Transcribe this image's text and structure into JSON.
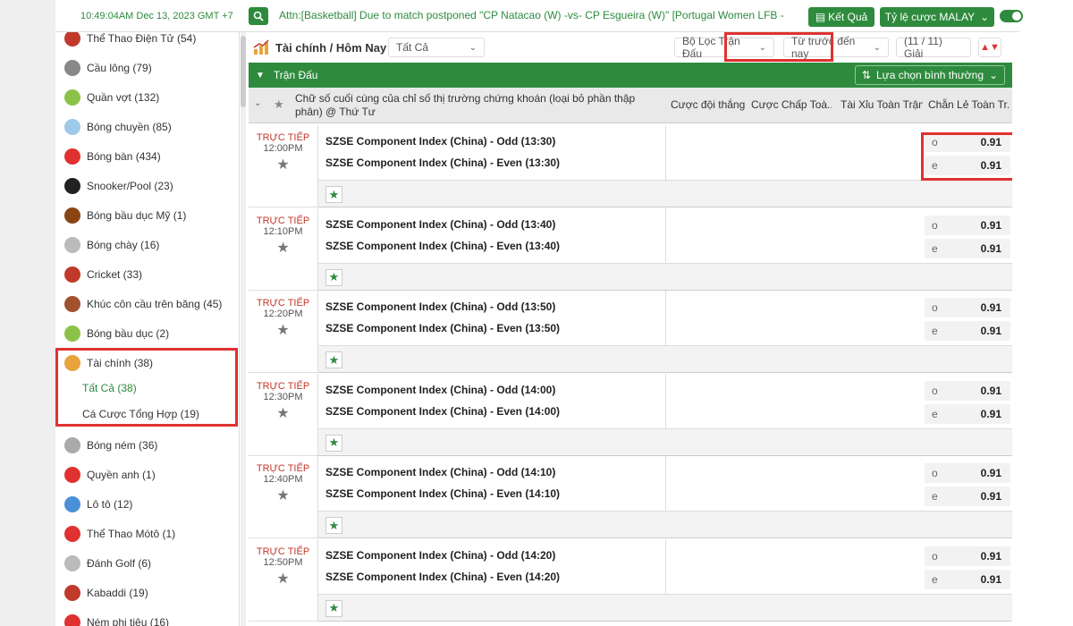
{
  "topbar": {
    "clock": "10:49:04AM Dec 13, 2023 GMT +7",
    "marquee": "Attn:[Basketball] Due to match postponed \"CP Natacao (W) -vs- CP Esgueira (W)\" [Portugal Women LFB -",
    "result_label": "Kết Quả",
    "odds_label": "Tỷ lệ cược MALAY"
  },
  "sidebar": {
    "items": [
      {
        "label": "Thể Thao Điện Tử (54)",
        "icon": "esports-icon",
        "color": "#c0392b"
      },
      {
        "label": "Cầu lông (79)",
        "icon": "badminton-icon",
        "color": "#888888"
      },
      {
        "label": "Quần vợt (132)",
        "icon": "tennis-icon",
        "color": "#8bc34a"
      },
      {
        "label": "Bóng chuyền (85)",
        "icon": "volleyball-icon",
        "color": "#9ec9e8"
      },
      {
        "label": "Bóng bàn (434)",
        "icon": "table-tennis-icon",
        "color": "#e03131"
      },
      {
        "label": "Snooker/Pool (23)",
        "icon": "snooker-icon",
        "color": "#222222"
      },
      {
        "label": "Bóng bầu dục Mỹ (1)",
        "icon": "american-football-icon",
        "color": "#8b4513"
      },
      {
        "label": "Bóng chày (16)",
        "icon": "baseball-icon",
        "color": "#bbbbbb"
      },
      {
        "label": "Cricket (33)",
        "icon": "cricket-icon",
        "color": "#c0392b"
      },
      {
        "label": "Khúc côn cầu trên băng (45)",
        "icon": "ice-hockey-icon",
        "color": "#a0522d"
      },
      {
        "label": "Bóng bầu dục (2)",
        "icon": "rugby-icon",
        "color": "#8bc34a"
      },
      {
        "label": "Tài chính (38)",
        "icon": "finance-icon",
        "color": "#e8a33c"
      }
    ],
    "sub_items": [
      {
        "label": "Tất Cả (38)"
      },
      {
        "label": "Cá Cược Tổng Hợp (19)"
      }
    ],
    "items_after": [
      {
        "label": "Bóng ném (36)",
        "icon": "handball-icon",
        "color": "#aaaaaa"
      },
      {
        "label": "Quyền anh (1)",
        "icon": "boxing-icon",
        "color": "#e03131"
      },
      {
        "label": "Lô tô (12)",
        "icon": "lotto-icon",
        "color": "#4a90d9"
      },
      {
        "label": "Thể Thao Mótô (1)",
        "icon": "motorsport-icon",
        "color": "#e03131"
      },
      {
        "label": "Đánh Golf (6)",
        "icon": "golf-icon",
        "color": "#bbbbbb"
      },
      {
        "label": "Kabaddi (19)",
        "icon": "kabaddi-icon",
        "color": "#c0392b"
      },
      {
        "label": "Ném phi tiêu (16)",
        "icon": "darts-icon",
        "color": "#e03131"
      }
    ]
  },
  "main": {
    "breadcrumb": "Tài chính / Hôm Nay",
    "filter_all": "Tất Cả",
    "match_filter": "Bộ Lọc Trận Đấu",
    "date_filter": "Từ trước đến nay",
    "league_count": "(11 / 11) Giải",
    "section_title": "Trận Đấu",
    "view_select": "Lựa chọn bình thường",
    "market_title": "Chữ số cuối cùng của chỉ số thị trường chứng khoán (loại bỏ phần thập phân) @ Thứ Tư",
    "columns": [
      "Cược đội thắng",
      "Cược Chấp Toà...",
      "Tài Xỉu Toàn Trận",
      "Chẵn Lẻ Toàn Tr..."
    ]
  },
  "matches": [
    {
      "live": "TRỰC TIẾP",
      "time": "12:00PM",
      "odd_name": "SZSE Component Index (China) - Odd (13:30)",
      "even_name": "SZSE Component Index (China) - Even (13:30)",
      "odd_label": "o",
      "odd_value": "0.91",
      "even_label": "e",
      "even_value": "0.91"
    },
    {
      "live": "TRỰC TIẾP",
      "time": "12:10PM",
      "odd_name": "SZSE Component Index (China) - Odd (13:40)",
      "even_name": "SZSE Component Index (China) - Even (13:40)",
      "odd_label": "o",
      "odd_value": "0.91",
      "even_label": "e",
      "even_value": "0.91"
    },
    {
      "live": "TRỰC TIẾP",
      "time": "12:20PM",
      "odd_name": "SZSE Component Index (China) - Odd (13:50)",
      "even_name": "SZSE Component Index (China) - Even (13:50)",
      "odd_label": "o",
      "odd_value": "0.91",
      "even_label": "e",
      "even_value": "0.91"
    },
    {
      "live": "TRỰC TIẾP",
      "time": "12:30PM",
      "odd_name": "SZSE Component Index (China) - Odd (14:00)",
      "even_name": "SZSE Component Index (China) - Even (14:00)",
      "odd_label": "o",
      "odd_value": "0.91",
      "even_label": "e",
      "even_value": "0.91"
    },
    {
      "live": "TRỰC TIẾP",
      "time": "12:40PM",
      "odd_name": "SZSE Component Index (China) - Odd (14:10)",
      "even_name": "SZSE Component Index (China) - Even (14:10)",
      "odd_label": "o",
      "odd_value": "0.91",
      "even_label": "e",
      "even_value": "0.91"
    },
    {
      "live": "TRỰC TIẾP",
      "time": "12:50PM",
      "odd_name": "SZSE Component Index (China) - Odd (14:20)",
      "even_name": "SZSE Component Index (China) - Even (14:20)",
      "odd_label": "o",
      "odd_value": "0.91",
      "even_label": "e",
      "even_value": "0.91"
    }
  ],
  "colors": {
    "brand_green": "#2e8b3e",
    "highlight_red": "#e03131",
    "live_red": "#c0392b"
  }
}
